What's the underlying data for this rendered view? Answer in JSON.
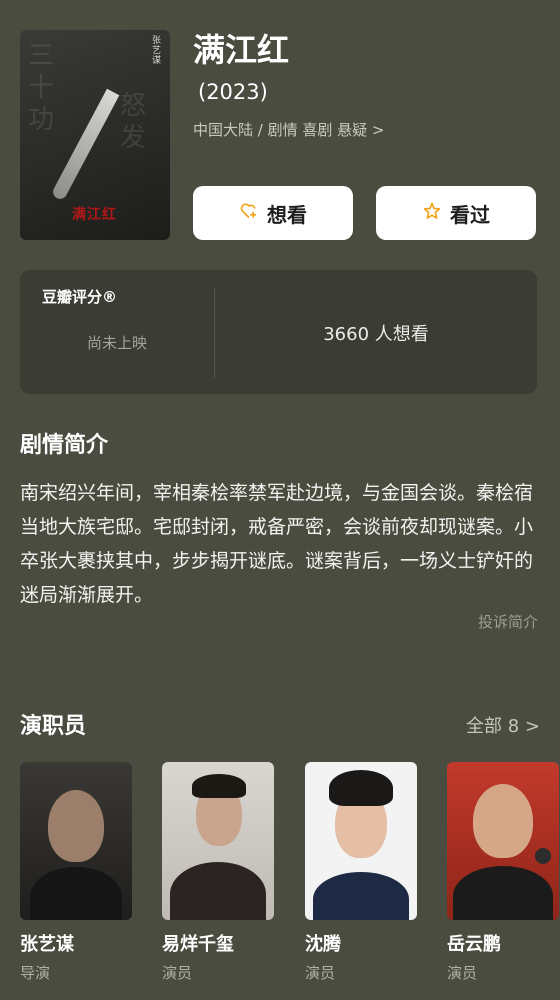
{
  "movie": {
    "title": "满江红",
    "year": "(2023)",
    "meta": "中国大陆 / 剧情 喜剧 悬疑 >",
    "poster_text": {
      "vertical": "张艺谋",
      "title": "满江红"
    }
  },
  "actions": {
    "want_label": "想看",
    "seen_label": "看过",
    "want_icon": "heart-plus-icon",
    "seen_icon": "star-icon"
  },
  "rating": {
    "label": "豆瓣评分®",
    "status": "尚未上映",
    "want_count": "3660 人想看"
  },
  "synopsis": {
    "heading": "剧情简介",
    "text": "南宋绍兴年间，宰相秦桧率禁军赴边境，与金国会谈。秦桧宿当地大族宅邸。宅邸封闭，戒备严密，会谈前夜却现谜案。小卒张大裹挟其中，步步揭开谜底。谜案背后，一场义士铲奸的迷局渐渐展开。",
    "report": "投诉简介"
  },
  "cast": {
    "heading": "演职员",
    "all_label": "全部 8 >",
    "members": [
      {
        "name": "张艺谋",
        "role": "导演"
      },
      {
        "name": "易烊千玺",
        "role": "演员"
      },
      {
        "name": "沈腾",
        "role": "演员"
      },
      {
        "name": "岳云鹏",
        "role": "演员"
      }
    ]
  },
  "colors": {
    "background": "#4a4c40",
    "card": "#3b3c33",
    "accent": "#f2a51c"
  }
}
